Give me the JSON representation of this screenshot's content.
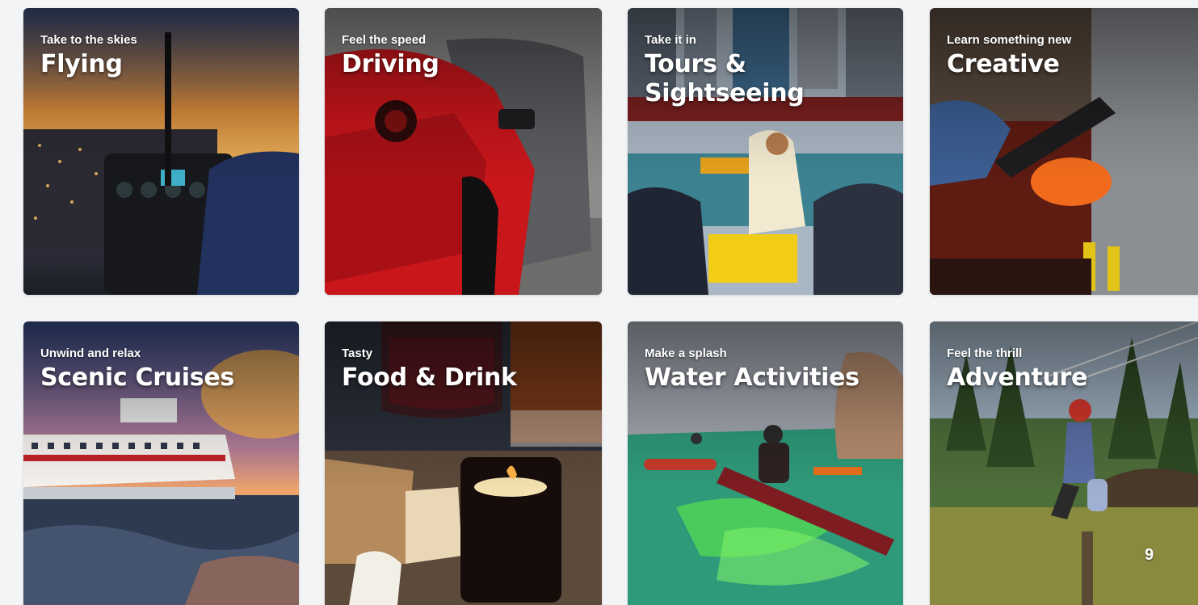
{
  "cards": [
    {
      "subtitle": "Take to the skies",
      "title": "Flying"
    },
    {
      "subtitle": "Feel the speed",
      "title": "Driving"
    },
    {
      "subtitle": "Take it in",
      "title": "Tours &\nSightseeing"
    },
    {
      "subtitle": "Learn something new",
      "title": "Creative"
    },
    {
      "subtitle": "Unwind and relax",
      "title": "Scenic Cruises"
    },
    {
      "subtitle": "Tasty",
      "title": "Food & Drink"
    },
    {
      "subtitle": "Make a splash",
      "title": "Water Activities"
    },
    {
      "subtitle": "Feel the thrill",
      "title": "Adventure"
    }
  ],
  "page_indicator": "9"
}
